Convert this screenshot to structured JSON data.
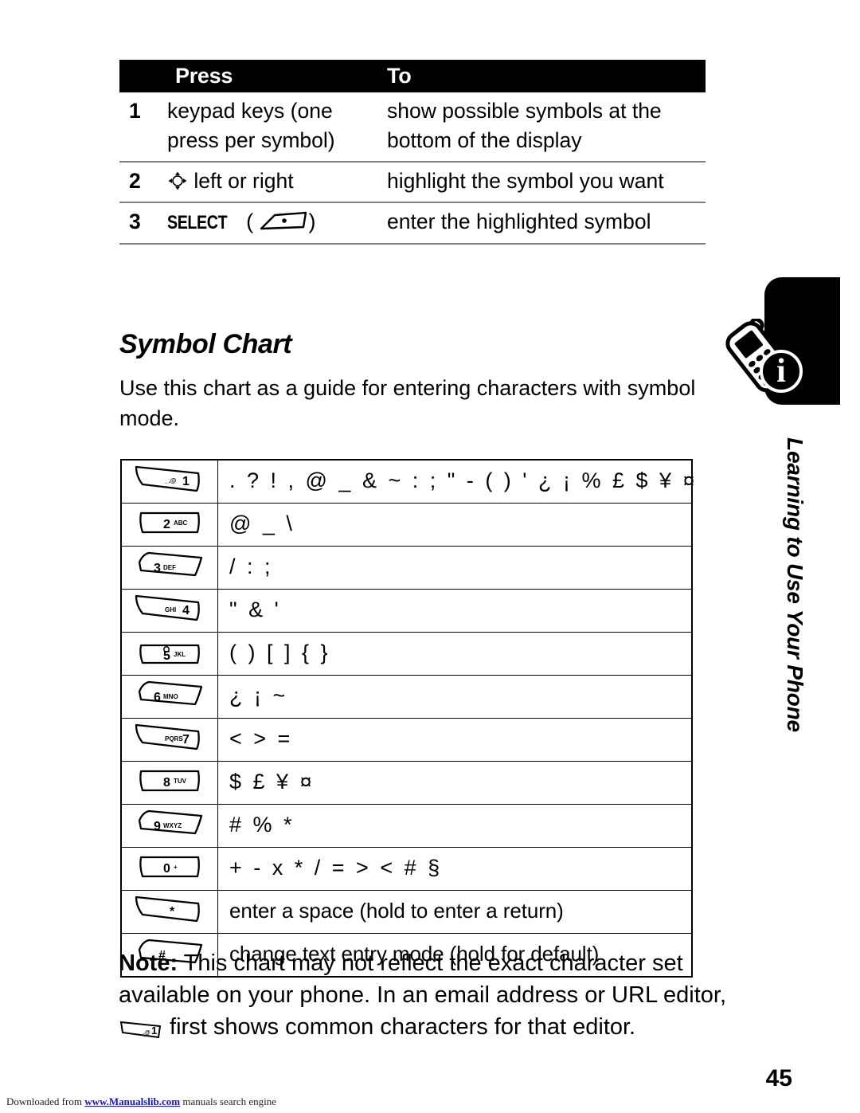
{
  "procedure_table": {
    "headers": [
      "Press",
      "To"
    ],
    "rows": [
      {
        "num": "1",
        "press": "keypad keys (one press per symbol)",
        "to": "show possible symbols at the bottom of the display",
        "press_icon": ""
      },
      {
        "num": "2",
        "press": "left or right",
        "to": "highlight the symbol you want",
        "press_icon": "navigation-key-icon"
      },
      {
        "num": "3",
        "press": "SELECT",
        "press_suffix": "( )",
        "to": "enter the highlighted symbol",
        "press_icon": "soft-key-icon"
      }
    ]
  },
  "section": {
    "heading": "Symbol Chart",
    "intro": "Use this chart as a guide for entering characters with symbol mode."
  },
  "symbol_chart": {
    "rows": [
      {
        "key": "1",
        "key_sub": "_.@",
        "key_style": "slant-left",
        "chars": ". ? ! , @ _ & ~ : ; \" - ( ) ' ¿ ¡ % £ $ ¥ ¤",
        "is_text": false
      },
      {
        "key": "2",
        "key_sub": "ABC",
        "key_style": "flat",
        "chars": "@ _ \\",
        "is_text": false
      },
      {
        "key": "3",
        "key_sub": "DEF",
        "key_style": "slant-right",
        "chars": "/ : ;",
        "is_text": false
      },
      {
        "key": "4",
        "key_sub": "GHI",
        "key_style": "slant-left",
        "chars": "\" & '",
        "is_text": false
      },
      {
        "key": "5",
        "key_sub": "JKL",
        "key_style": "flat-dot",
        "chars": "( ) [ ] { }",
        "is_text": false
      },
      {
        "key": "6",
        "key_sub": "MNO",
        "key_style": "slant-right",
        "chars": "¿ ¡ ~",
        "is_text": false
      },
      {
        "key": "7",
        "key_sub": "PQRS",
        "key_style": "slant-left",
        "chars": "< > =",
        "is_text": false
      },
      {
        "key": "8",
        "key_sub": "TUV",
        "key_style": "flat",
        "chars": "$ £ ¥ ¤",
        "is_text": false
      },
      {
        "key": "9",
        "key_sub": "WXYZ",
        "key_style": "slant-right",
        "chars": "# % *",
        "is_text": false
      },
      {
        "key": "0",
        "key_sub": "+",
        "key_style": "flat",
        "chars": "+ - x * / = > < # §",
        "is_text": false
      },
      {
        "key": "*",
        "key_sub": "",
        "key_style": "slant-left",
        "chars": "enter a space (hold to enter a return)",
        "is_text": true
      },
      {
        "key": "#",
        "key_sub": "",
        "key_style": "slant-right",
        "chars": "change text entry mode (hold for default)",
        "is_text": true
      }
    ]
  },
  "note": {
    "label": "Note:",
    "text_part1": " This chart may not reflect the exact character set available on your phone. In an email address or URL editor, ",
    "text_part2": " first shows common characters for that editor.",
    "inline_icon": "key-1-icon"
  },
  "sidebar": {
    "label": "Learning to Use Your Phone",
    "icon": "phone-info-icon",
    "tab_color": "#000000"
  },
  "page_number": "45",
  "footer": {
    "prefix": "Downloaded from ",
    "link": "www.Manualslib.com",
    "suffix": " manuals search engine",
    "link_color": "#1414d2"
  }
}
